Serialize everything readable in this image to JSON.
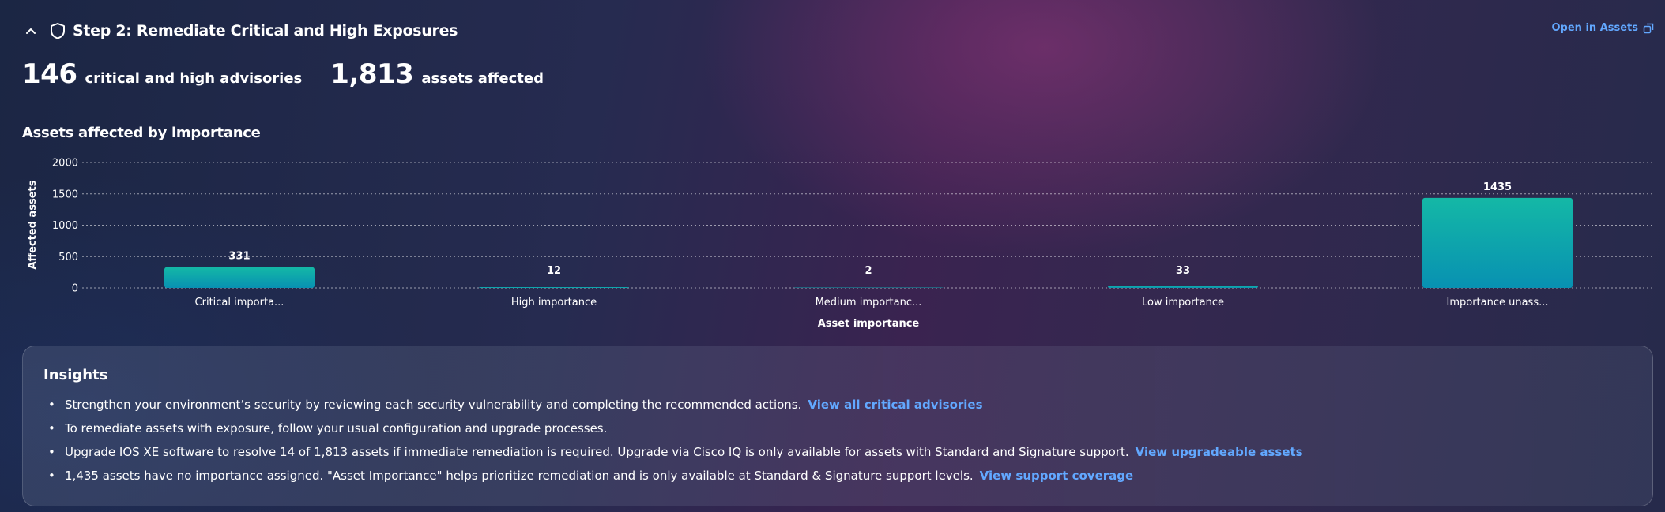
{
  "header": {
    "title": "Step 2: Remediate Critical and High Exposures",
    "open_link": "Open in Assets"
  },
  "metrics": {
    "advisories_count": "146",
    "advisories_label": "critical and high advisories",
    "assets_count": "1,813",
    "assets_label": "assets affected"
  },
  "chart_title": "Assets affected by importance",
  "chart_data": {
    "type": "bar",
    "categories": [
      "Critical importa...",
      "High importance",
      "Medium importanc...",
      "Low importance",
      "Importance unass..."
    ],
    "values": [
      331,
      12,
      2,
      33,
      1435
    ],
    "data_labels": [
      "331",
      "12",
      "2",
      "33",
      "1435"
    ],
    "xlabel": "Asset importance",
    "ylabel": "Affected assets",
    "ylim": [
      0,
      2000
    ],
    "yticks": [
      "2000",
      "1500",
      "1000",
      "500",
      "0"
    ],
    "ytick_values": [
      2000,
      1500,
      1000,
      500,
      0
    ],
    "grid": true,
    "colors": {
      "bar_top": "#14b8a6",
      "bar_bottom": "#0891b2"
    }
  },
  "insights": {
    "title": "Insights",
    "items": [
      {
        "text": "Strengthen your environment’s security by reviewing each security vulnerability and completing the recommended actions.",
        "link": "View all critical advisories"
      },
      {
        "text": "To remediate assets with exposure, follow your usual configuration and upgrade processes.",
        "link": ""
      },
      {
        "text": "Upgrade IOS XE software to resolve 14 of 1,813 assets if immediate remediation is required. Upgrade via Cisco IQ is only available for assets with Standard and Signature support.",
        "link": "View upgradeable assets"
      },
      {
        "text": "1,435 assets have no importance assigned. \"Asset Importance\" helps prioritize remediation and is only available at Standard & Signature support levels.",
        "link": "View support coverage"
      }
    ]
  },
  "colors": {
    "accent": "#62a8ff",
    "text": "#ffffff"
  }
}
